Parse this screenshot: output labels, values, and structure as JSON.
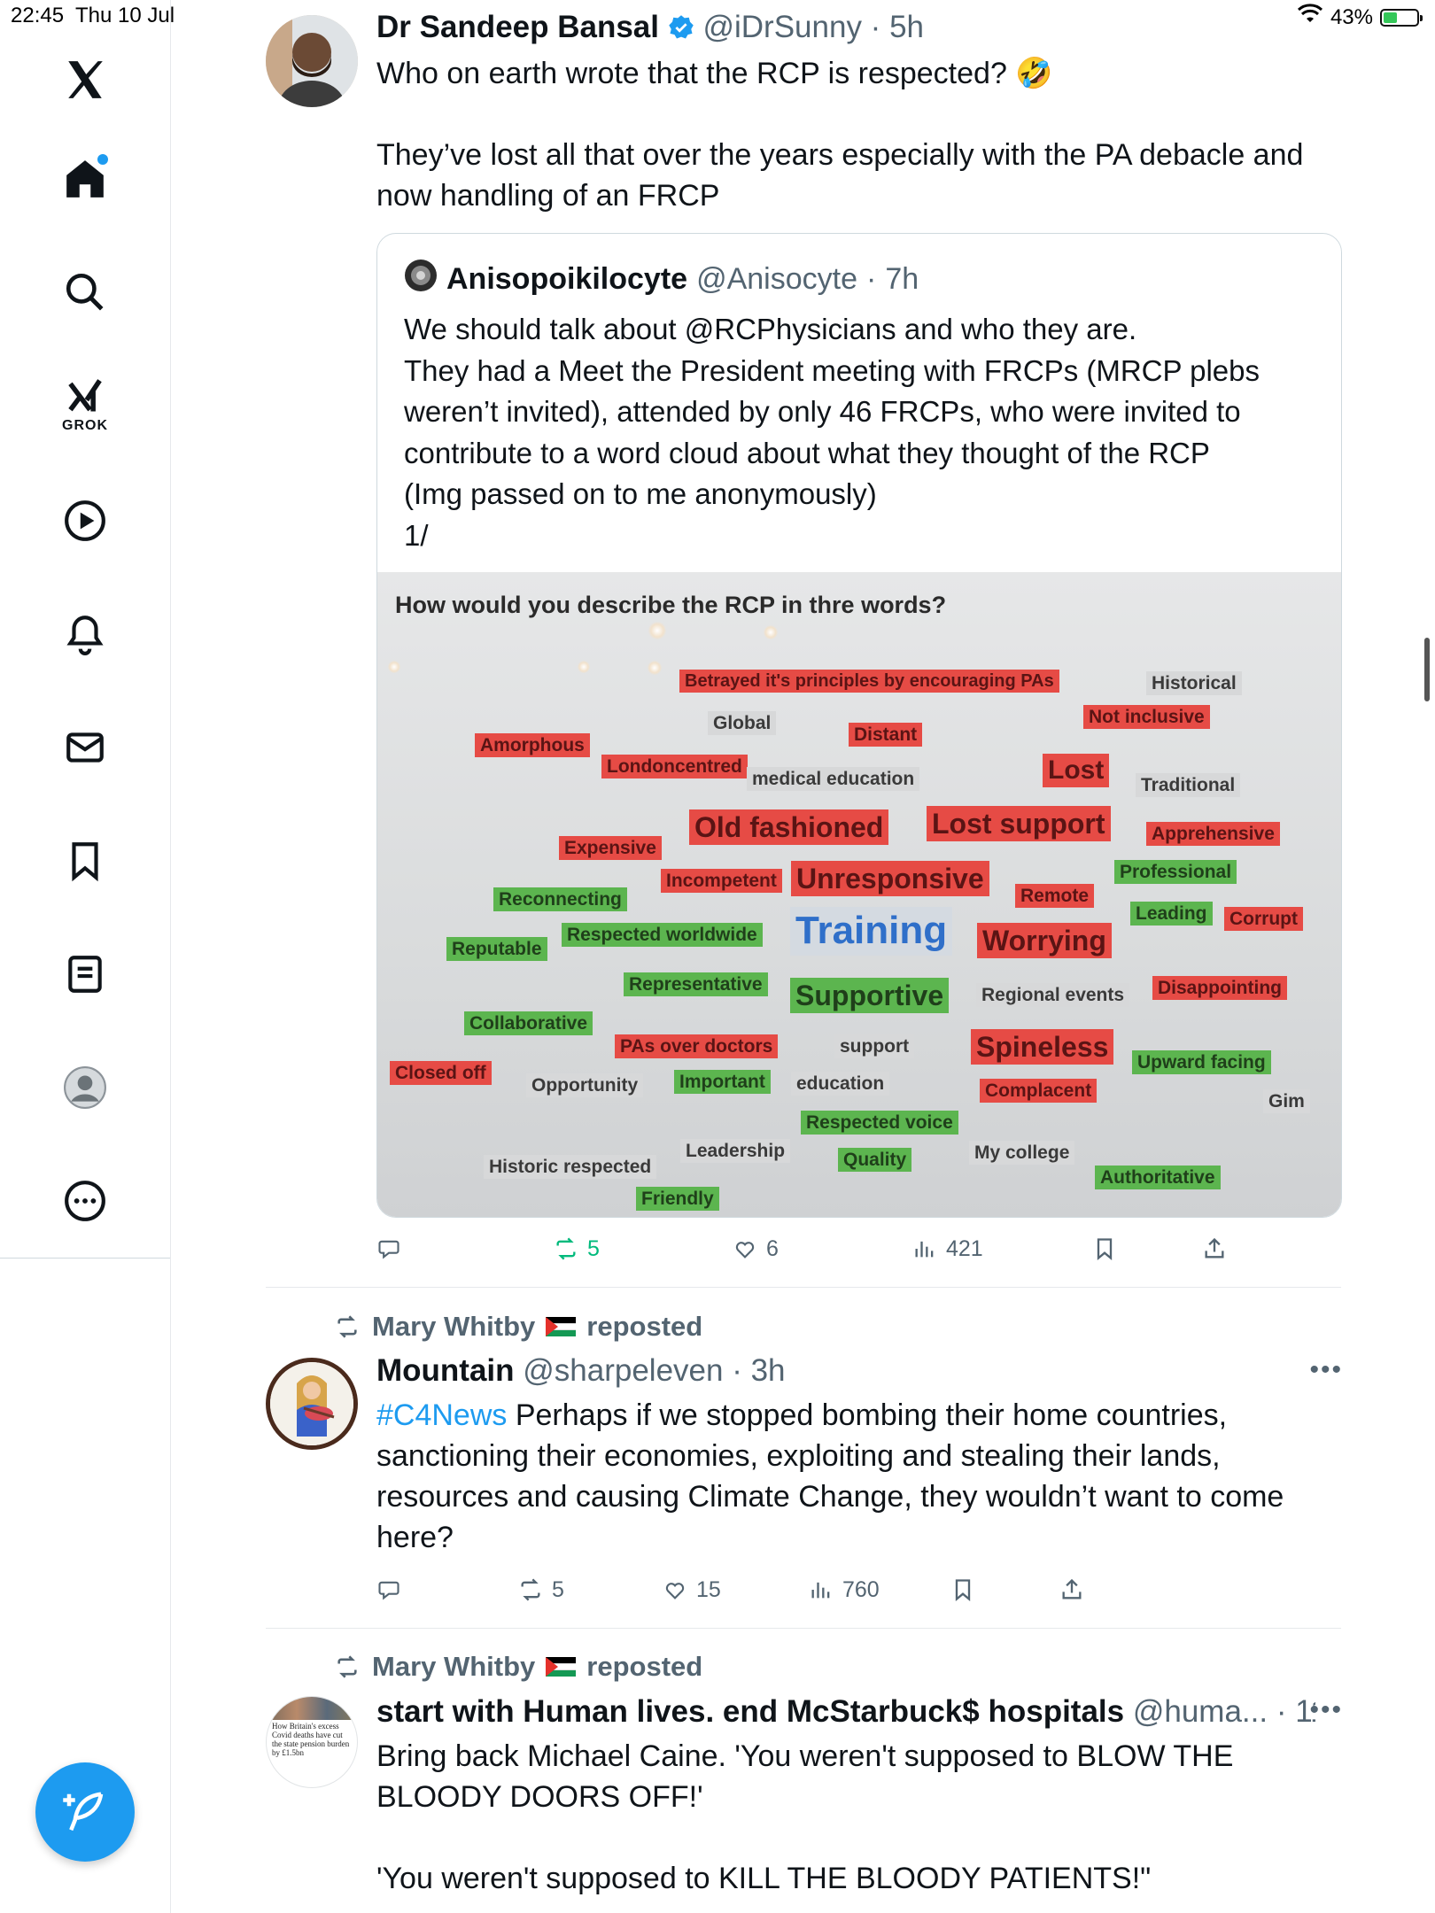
{
  "status_bar": {
    "time": "22:45",
    "date": "Thu 10 Jul",
    "battery": "43%",
    "battery_level": 0.43
  },
  "sidebar": {
    "items": [
      {
        "icon": "x-logo-icon"
      },
      {
        "icon": "home-icon"
      },
      {
        "icon": "search-icon"
      },
      {
        "icon": "grok-icon",
        "label": "GROK"
      },
      {
        "icon": "play-icon"
      },
      {
        "icon": "bell-icon"
      },
      {
        "icon": "mail-icon"
      },
      {
        "icon": "bookmark-icon"
      },
      {
        "icon": "list-icon"
      },
      {
        "icon": "profile-icon"
      },
      {
        "icon": "more-icon"
      }
    ],
    "accent": "#1d9bf0"
  },
  "tweet1": {
    "name": "Dr Sandeep Bansal",
    "handle": "@iDrSunny",
    "time": "5h",
    "text_line1": "Who on earth wrote that the RCP is respected? 🤣",
    "text_line2": "They’ve lost all that over the years especially with the PA debacle and now handling of an FRCP",
    "quote": {
      "name": "Anisopoikilocyte",
      "handle": "@Anisocyte",
      "time": "7h",
      "lines": [
        "We should talk about @RCPhysicians and who they are.",
        "They had a Meet the President meeting with FRCPs (MRCP plebs weren’t invited), attended by only 46 FRCPs, who were invited to contribute to a word cloud about what they thought of the RCP",
        "(Img passed on to me anonymously)",
        "1/"
      ],
      "wordcloud": {
        "title": "How would you describe the RCP in thre  words?",
        "words": [
          "Betrayed it's principles by encouraging PAs",
          "Historical",
          "Global",
          "Distant",
          "Not inclusive",
          "Amorphous",
          "Londoncentred",
          "medical education",
          "Lost",
          "Traditional",
          "Old fashioned",
          "Lost support",
          "Apprehensive",
          "Expensive",
          "Incompetent",
          "Unresponsive",
          "Professional",
          "Reconnecting",
          "Remote",
          "Leading",
          "Corrupt",
          "Reputable",
          "Respected worldwide",
          "Training",
          "Worrying",
          "Representative",
          "Supportive",
          "Regional events",
          "Disappointing",
          "Collaborative",
          "PAs over doctors",
          "support",
          "Spineless",
          "Upward facing",
          "Closed off",
          "Opportunity",
          "Important",
          "education",
          "Complacent",
          "Gim",
          "Respected voice",
          "Historic respected",
          "Leadership",
          "Quality",
          "My college",
          "Authoritative",
          "Friendly"
        ]
      }
    },
    "stats": {
      "replies": "",
      "reposts": "5",
      "likes": "6",
      "views": "421"
    }
  },
  "tweet2": {
    "reposted_by": "Mary Whitby",
    "reposted_label": "reposted",
    "name": "Mountain",
    "handle": "@sharpeleven",
    "time": "3h",
    "hashtag": "#C4News",
    "text": " Perhaps if we stopped bombing their home countries, sanctioning their economies, exploiting and stealing their lands, resources and causing Climate Change, they wouldn’t want to come here?",
    "stats": {
      "replies": "",
      "reposts": "5",
      "likes": "15",
      "views": "760"
    }
  },
  "tweet3": {
    "reposted_by": "Mary Whitby",
    "reposted_label": "reposted",
    "name": "start with Human lives. end McStarbuck$ hospitals",
    "handle": "@huma...",
    "time": "11h",
    "text_line1": "Bring back Michael Caine.  'You weren't supposed to BLOW THE BLOODY DOORS OFF!'",
    "text_line2": "'You weren't supposed to KILL THE BLOODY PATIENTS!\"",
    "avatar_text": "How Britain's excess Covid deaths have cut the state pension burden by £1.5bn"
  }
}
